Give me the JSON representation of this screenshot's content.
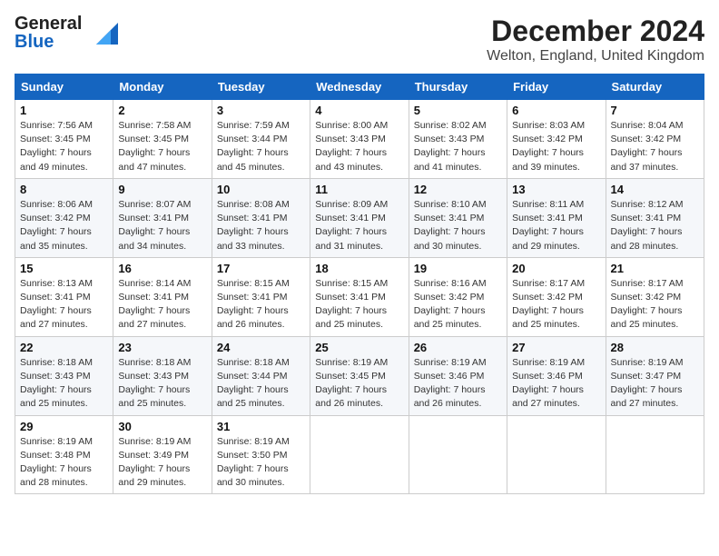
{
  "logo": {
    "general": "General",
    "blue": "Blue"
  },
  "title": "December 2024",
  "subtitle": "Welton, England, United Kingdom",
  "headers": [
    "Sunday",
    "Monday",
    "Tuesday",
    "Wednesday",
    "Thursday",
    "Friday",
    "Saturday"
  ],
  "weeks": [
    [
      {
        "day": "1",
        "sunrise": "7:56 AM",
        "sunset": "3:45 PM",
        "daylight": "7 hours and 49 minutes."
      },
      {
        "day": "2",
        "sunrise": "7:58 AM",
        "sunset": "3:45 PM",
        "daylight": "7 hours and 47 minutes."
      },
      {
        "day": "3",
        "sunrise": "7:59 AM",
        "sunset": "3:44 PM",
        "daylight": "7 hours and 45 minutes."
      },
      {
        "day": "4",
        "sunrise": "8:00 AM",
        "sunset": "3:43 PM",
        "daylight": "7 hours and 43 minutes."
      },
      {
        "day": "5",
        "sunrise": "8:02 AM",
        "sunset": "3:43 PM",
        "daylight": "7 hours and 41 minutes."
      },
      {
        "day": "6",
        "sunrise": "8:03 AM",
        "sunset": "3:42 PM",
        "daylight": "7 hours and 39 minutes."
      },
      {
        "day": "7",
        "sunrise": "8:04 AM",
        "sunset": "3:42 PM",
        "daylight": "7 hours and 37 minutes."
      }
    ],
    [
      {
        "day": "8",
        "sunrise": "8:06 AM",
        "sunset": "3:42 PM",
        "daylight": "7 hours and 35 minutes."
      },
      {
        "day": "9",
        "sunrise": "8:07 AM",
        "sunset": "3:41 PM",
        "daylight": "7 hours and 34 minutes."
      },
      {
        "day": "10",
        "sunrise": "8:08 AM",
        "sunset": "3:41 PM",
        "daylight": "7 hours and 33 minutes."
      },
      {
        "day": "11",
        "sunrise": "8:09 AM",
        "sunset": "3:41 PM",
        "daylight": "7 hours and 31 minutes."
      },
      {
        "day": "12",
        "sunrise": "8:10 AM",
        "sunset": "3:41 PM",
        "daylight": "7 hours and 30 minutes."
      },
      {
        "day": "13",
        "sunrise": "8:11 AM",
        "sunset": "3:41 PM",
        "daylight": "7 hours and 29 minutes."
      },
      {
        "day": "14",
        "sunrise": "8:12 AM",
        "sunset": "3:41 PM",
        "daylight": "7 hours and 28 minutes."
      }
    ],
    [
      {
        "day": "15",
        "sunrise": "8:13 AM",
        "sunset": "3:41 PM",
        "daylight": "7 hours and 27 minutes."
      },
      {
        "day": "16",
        "sunrise": "8:14 AM",
        "sunset": "3:41 PM",
        "daylight": "7 hours and 27 minutes."
      },
      {
        "day": "17",
        "sunrise": "8:15 AM",
        "sunset": "3:41 PM",
        "daylight": "7 hours and 26 minutes."
      },
      {
        "day": "18",
        "sunrise": "8:15 AM",
        "sunset": "3:41 PM",
        "daylight": "7 hours and 25 minutes."
      },
      {
        "day": "19",
        "sunrise": "8:16 AM",
        "sunset": "3:42 PM",
        "daylight": "7 hours and 25 minutes."
      },
      {
        "day": "20",
        "sunrise": "8:17 AM",
        "sunset": "3:42 PM",
        "daylight": "7 hours and 25 minutes."
      },
      {
        "day": "21",
        "sunrise": "8:17 AM",
        "sunset": "3:42 PM",
        "daylight": "7 hours and 25 minutes."
      }
    ],
    [
      {
        "day": "22",
        "sunrise": "8:18 AM",
        "sunset": "3:43 PM",
        "daylight": "7 hours and 25 minutes."
      },
      {
        "day": "23",
        "sunrise": "8:18 AM",
        "sunset": "3:43 PM",
        "daylight": "7 hours and 25 minutes."
      },
      {
        "day": "24",
        "sunrise": "8:18 AM",
        "sunset": "3:44 PM",
        "daylight": "7 hours and 25 minutes."
      },
      {
        "day": "25",
        "sunrise": "8:19 AM",
        "sunset": "3:45 PM",
        "daylight": "7 hours and 26 minutes."
      },
      {
        "day": "26",
        "sunrise": "8:19 AM",
        "sunset": "3:46 PM",
        "daylight": "7 hours and 26 minutes."
      },
      {
        "day": "27",
        "sunrise": "8:19 AM",
        "sunset": "3:46 PM",
        "daylight": "7 hours and 27 minutes."
      },
      {
        "day": "28",
        "sunrise": "8:19 AM",
        "sunset": "3:47 PM",
        "daylight": "7 hours and 27 minutes."
      }
    ],
    [
      {
        "day": "29",
        "sunrise": "8:19 AM",
        "sunset": "3:48 PM",
        "daylight": "7 hours and 28 minutes."
      },
      {
        "day": "30",
        "sunrise": "8:19 AM",
        "sunset": "3:49 PM",
        "daylight": "7 hours and 29 minutes."
      },
      {
        "day": "31",
        "sunrise": "8:19 AM",
        "sunset": "3:50 PM",
        "daylight": "7 hours and 30 minutes."
      },
      null,
      null,
      null,
      null
    ]
  ]
}
